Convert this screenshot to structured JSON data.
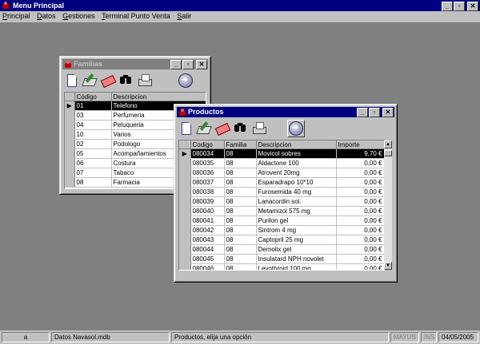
{
  "app": {
    "title": "Menu Principal"
  },
  "menu": [
    "Principal",
    "Datos",
    "Gestiones",
    "Terminal Punto Venta",
    "Salir"
  ],
  "familias": {
    "title": "Familias",
    "columns": [
      "Código",
      "Descripcion"
    ],
    "rows": [
      [
        "01",
        "Telefono"
      ],
      [
        "03",
        "Perfumeria"
      ],
      [
        "04",
        "Peluqueria"
      ],
      [
        "10",
        "Varios"
      ],
      [
        "02",
        "Podologo"
      ],
      [
        "05",
        "Acompañamientos"
      ],
      [
        "06",
        "Costura"
      ],
      [
        "07",
        "Tabaco"
      ],
      [
        "08",
        "Farmacia"
      ]
    ]
  },
  "productos": {
    "title": "Productos",
    "columns": [
      "Codigo",
      "Familia",
      "Descripcion",
      "Importe"
    ],
    "rows": [
      [
        "080034",
        "08",
        "Movicol sobres",
        "9,70 €"
      ],
      [
        "080035",
        "08",
        "Aldactone 100",
        "0,00 €"
      ],
      [
        "080036",
        "08",
        "Atrovent 20mg",
        "0,00 €"
      ],
      [
        "080037",
        "08",
        "Esparadrapo 10*10",
        "0,00 €"
      ],
      [
        "080038",
        "08",
        "Furosemida 40 mg",
        "0,00 €"
      ],
      [
        "080039",
        "08",
        "Lanacordin sol.",
        "0,00 €"
      ],
      [
        "080040",
        "08",
        "Metamizol 575 mg",
        "0,00 €"
      ],
      [
        "080041",
        "08",
        "Purilon gel",
        "0,00 €"
      ],
      [
        "080042",
        "08",
        "Sintrom 4 mg",
        "0,00 €"
      ],
      [
        "080043",
        "08",
        "Captopril 25 mg",
        "0,00 €"
      ],
      [
        "080044",
        "08",
        "Demolix gel",
        "0,00 €"
      ],
      [
        "080045",
        "08",
        "Insulatard NPH novolet",
        "0,00 €"
      ],
      [
        "080046",
        "08",
        "Levothroid 100 mg",
        "0,00 €"
      ]
    ]
  },
  "status": {
    "panel1": "a",
    "panel2": "Datos Navasol.mdb",
    "panel3": "Productos, elija una opción",
    "mayus": "MAYUS",
    "ins": "INS",
    "date": "04/05/2005"
  },
  "icons": {
    "toolbar": [
      "new-icon",
      "edit-icon",
      "erase-icon",
      "find-icon",
      "print-icon",
      "go-icon"
    ]
  }
}
